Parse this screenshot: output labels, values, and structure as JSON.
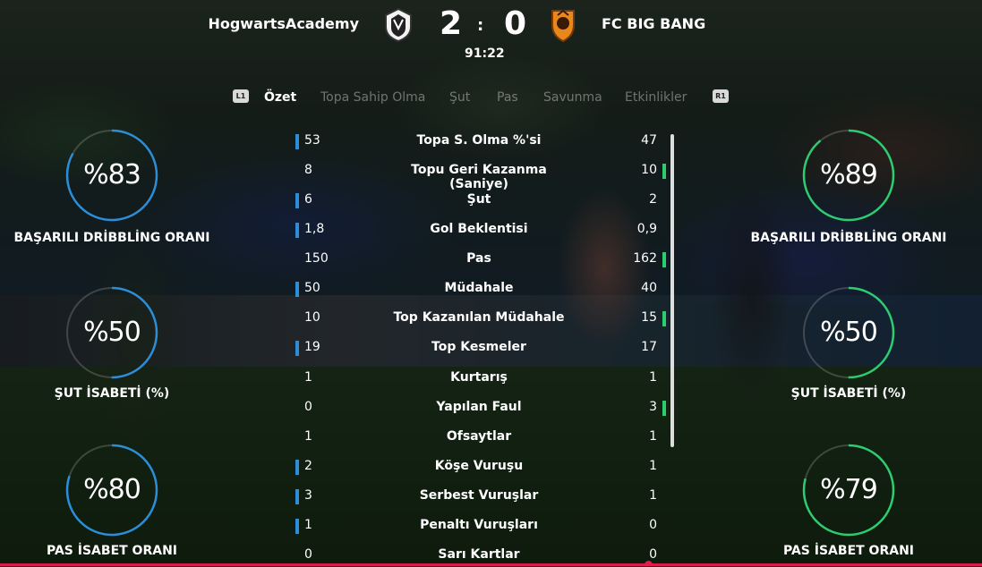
{
  "header": {
    "home_team": "HogwartsAcademy",
    "away_team": "FC BIG BANG",
    "home_score": "2",
    "away_score": "0",
    "separator": ":",
    "clock": "91:22"
  },
  "tabs": {
    "left_button": "L1",
    "right_button": "R1",
    "items": [
      {
        "label": "Özet",
        "active": true
      },
      {
        "label": "Topa Sahip Olma",
        "active": false
      },
      {
        "label": "Şut",
        "active": false
      },
      {
        "label": "Pas",
        "active": false
      },
      {
        "label": "Savunma",
        "active": false
      },
      {
        "label": "Etkinlikler",
        "active": false
      }
    ]
  },
  "gauges": {
    "home": [
      {
        "value": "%83",
        "pct": 83,
        "label": "BAŞARILI DRİBBLİNG ORANI"
      },
      {
        "value": "%50",
        "pct": 50,
        "label": "ŞUT İSABETİ (%)"
      },
      {
        "value": "%80",
        "pct": 80,
        "label": "PAS İSABET ORANI"
      }
    ],
    "away": [
      {
        "value": "%89",
        "pct": 89,
        "label": "BAŞARILI DRİBBLİNG ORANI"
      },
      {
        "value": "%50",
        "pct": 50,
        "label": "ŞUT İSABETİ (%)"
      },
      {
        "value": "%79",
        "pct": 79,
        "label": "PAS İSABET ORANI"
      }
    ]
  },
  "colors": {
    "home_accent": "#2c8ed8",
    "away_accent": "#2ecc71",
    "active_line": "#d91c4a"
  },
  "stats": [
    {
      "label": "Topa S. Olma %'si",
      "home": "53",
      "away": "47",
      "leader": "home"
    },
    {
      "label": "Topu Geri Kazanma (Saniye)",
      "home": "8",
      "away": "10",
      "leader": "away"
    },
    {
      "label": "Şut",
      "home": "6",
      "away": "2",
      "leader": "home"
    },
    {
      "label": "Gol Beklentisi",
      "home": "1,8",
      "away": "0,9",
      "leader": "home"
    },
    {
      "label": "Pas",
      "home": "150",
      "away": "162",
      "leader": "away"
    },
    {
      "label": "Müdahale",
      "home": "50",
      "away": "40",
      "leader": "home"
    },
    {
      "label": "Top Kazanılan Müdahale",
      "home": "10",
      "away": "15",
      "leader": "away"
    },
    {
      "label": "Top Kesmeler",
      "home": "19",
      "away": "17",
      "leader": "home"
    },
    {
      "label": "Kurtarış",
      "home": "1",
      "away": "1",
      "leader": "none"
    },
    {
      "label": "Yapılan Faul",
      "home": "0",
      "away": "3",
      "leader": "away"
    },
    {
      "label": "Ofsaytlar",
      "home": "1",
      "away": "1",
      "leader": "none"
    },
    {
      "label": "Köşe Vuruşu",
      "home": "2",
      "away": "1",
      "leader": "home"
    },
    {
      "label": "Serbest Vuruşlar",
      "home": "3",
      "away": "1",
      "leader": "home"
    },
    {
      "label": "Penaltı Vuruşları",
      "home": "1",
      "away": "0",
      "leader": "home"
    },
    {
      "label": "Sarı Kartlar",
      "home": "0",
      "away": "0",
      "leader": "none"
    }
  ]
}
